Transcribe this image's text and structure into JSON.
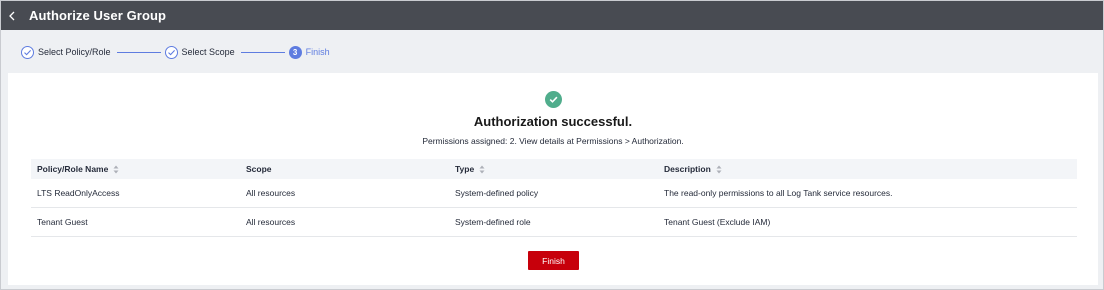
{
  "header": {
    "title": "Authorize User Group"
  },
  "steps": [
    {
      "label": "Select Policy/Role",
      "state": "done"
    },
    {
      "label": "Select Scope",
      "state": "done"
    },
    {
      "number": "3",
      "label": "Finish",
      "state": "active"
    }
  ],
  "result": {
    "title": "Authorization successful.",
    "message": "Permissions assigned: 2. View details at Permissions > Authorization."
  },
  "table": {
    "headers": [
      "Policy/Role Name",
      "Scope",
      "Type",
      "Description"
    ],
    "rows": [
      [
        "LTS ReadOnlyAccess",
        "All resources",
        "System-defined policy",
        "The read-only permissions to all Log Tank service resources."
      ],
      [
        "Tenant Guest",
        "All resources",
        "System-defined role",
        "Tenant Guest (Exclude IAM)"
      ]
    ]
  },
  "actions": {
    "finish_label": "Finish"
  },
  "colors": {
    "header_bg": "#484b52",
    "step_accent": "#5e7ce0",
    "success": "#50ad8c",
    "primary_button": "#c7000b"
  }
}
